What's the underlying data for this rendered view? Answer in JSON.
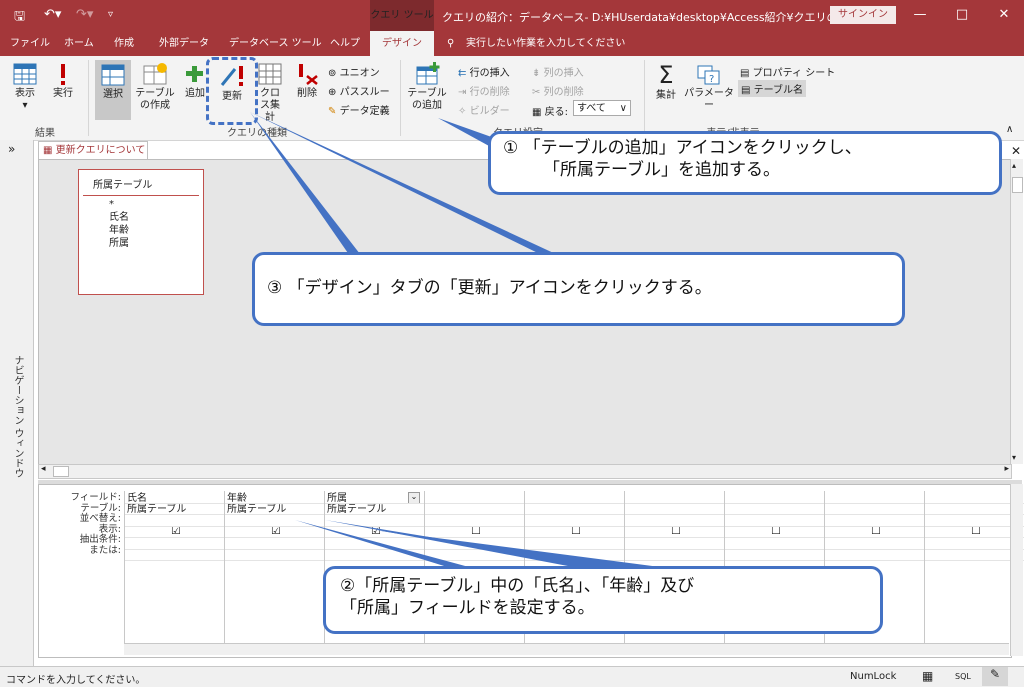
{
  "titlebar": {
    "context_tools": "クエリ ツール",
    "document_title": "クエリの紹介：データベース- D:¥HUserdata¥desktop¥Access紹介¥クエリの紹介.ac...",
    "signin": "サインイン",
    "minimize": "—",
    "restore": "□",
    "close": "✕"
  },
  "tabs": [
    "ファイル",
    "ホーム",
    "作成",
    "外部データ",
    "データベース ツール",
    "ヘルプ",
    "デザイン"
  ],
  "tell_me": "実行したい作業を入力してください",
  "ribbon": {
    "results": {
      "view": "表示",
      "run": "実行",
      "group": "結果"
    },
    "query_type": {
      "select": "選択",
      "make_table": "テーブルの作成",
      "append": "追加",
      "update": "更新",
      "crosstab": "クロス集計",
      "delete": "削除",
      "union": "ユニオン",
      "passthrough": "パススルー",
      "data_definition": "データ定義",
      "group": "クエリの種類"
    },
    "setup": {
      "add_table": "テーブルの追加",
      "insert_rows": "行の挿入",
      "delete_rows": "行の削除",
      "builder": "ビルダー",
      "insert_columns": "列の挿入",
      "delete_columns": "列の削除",
      "return": "戻る:",
      "return_value": "すべて",
      "group": "クエリ設定"
    },
    "show_hide": {
      "totals": "集計",
      "parameters": "パラメーター",
      "property_sheet": "プロパティ シート",
      "table_names": "テーブル名",
      "group": "表示/非表示"
    }
  },
  "nav_pane": {
    "label": "ナビゲーション ウィンドウ",
    "toggle": "»"
  },
  "document_tab": "更新クエリについて",
  "table_box": {
    "title": "所属テーブル",
    "fields": [
      "*",
      "氏名",
      "年齢",
      "所属"
    ]
  },
  "grid": {
    "row_labels": [
      "フィールド:",
      "テーブル:",
      "並べ替え:",
      "表示:",
      "抽出条件:",
      "または:"
    ],
    "columns": [
      {
        "field": "氏名",
        "table": "所属テーブル",
        "show": "☑"
      },
      {
        "field": "年齢",
        "table": "所属テーブル",
        "show": "☑"
      },
      {
        "field": "所属",
        "table": "所属テーブル",
        "show": "☑"
      },
      {
        "field": "",
        "table": "",
        "show": "☐"
      },
      {
        "field": "",
        "table": "",
        "show": "☐"
      },
      {
        "field": "",
        "table": "",
        "show": "☐"
      },
      {
        "field": "",
        "table": "",
        "show": "☐"
      },
      {
        "field": "",
        "table": "",
        "show": "☐"
      },
      {
        "field": "",
        "table": "",
        "show": "☐"
      }
    ]
  },
  "statusbar": {
    "message": "コマンドを入力してください。",
    "numlock": "NumLock",
    "sql": "SQL"
  },
  "callouts": {
    "step1_line1": "① 「テーブルの追加」アイコンをクリックし、",
    "step1_line2": "「所属テーブル」を追加する。",
    "step2_line1": "②「所属テーブル」中の「氏名」、「年齢」及び",
    "step2_line2": "「所属」フィールドを設定する。",
    "step3": "③ 「デザイン」タブの「更新」アイコンをクリックする。"
  },
  "colors": {
    "access_red": "#a4373a",
    "callout_blue": "#4472c4",
    "run_red": "#c00000"
  }
}
